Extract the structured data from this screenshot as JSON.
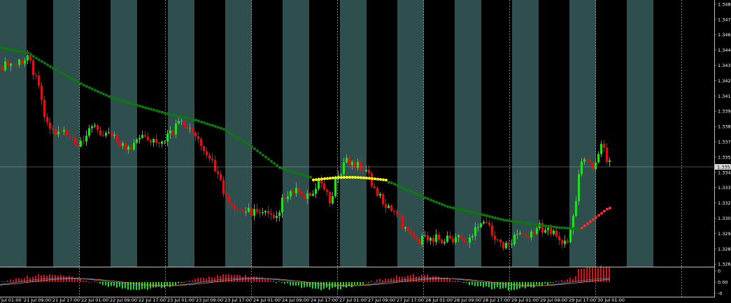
{
  "colors": {
    "background": "#000000",
    "session_band": "#2f4f4f",
    "bull": "#22dd22",
    "bear": "#dd1111",
    "ma_green": "#0c7a0c",
    "ma_yellow": "#ffff00",
    "ma_red": "#ff2a2a",
    "grid": "#b0b0b0",
    "text": "#ffffff",
    "price_tag_bg": "#d8d8d8",
    "price_tag_text": "#000000"
  },
  "price_axis": {
    "labels": [
      "1.3486",
      "1.3473",
      "1.3461",
      "1.3448",
      "1.3435",
      "1.3422",
      "1.3410",
      "1.3397",
      "1.3384",
      "1.3371",
      "1.3358",
      "1.3346",
      "1.3333",
      "1.3320",
      "1.3307",
      "1.3295",
      "1.3282",
      "1.3269"
    ],
    "current_price": "1.3353"
  },
  "oscillator_axis": {
    "labels": [
      "0",
      "0.00",
      "-0"
    ]
  },
  "time_axis": {
    "labels": [
      "Jul 01:00",
      "21 Jul 09:00",
      "21 Jul 17:00",
      "22 Jul 01:00",
      "22 Jul 09:00",
      "22 Jul 17:00",
      "23 Jul 01:00",
      "23 Jul 09:00",
      "23 Jul 17:00",
      "24 Jul 01:00",
      "24 Jul 09:00",
      "24 Jul 17:00",
      "27 Jul 01:00",
      "27 Jul 09:00",
      "27 Jul 17:00",
      "28 Jul 01:00",
      "28 Jul 09:00",
      "28 Jul 17:00",
      "29 Jul 01:00",
      "29 Jul 09:00",
      "29 Jul 17:00",
      "30 Jul 01:00"
    ]
  },
  "chart_data": {
    "type": "candlestick",
    "y_range": [
      1.3262,
      1.3492
    ],
    "moving_average": "dotted, colored by trend (green / yellow / red)",
    "oscillator": "histogram with signal lines in lower subwindow",
    "grid": "dotted vertical lines at day boundaries"
  }
}
